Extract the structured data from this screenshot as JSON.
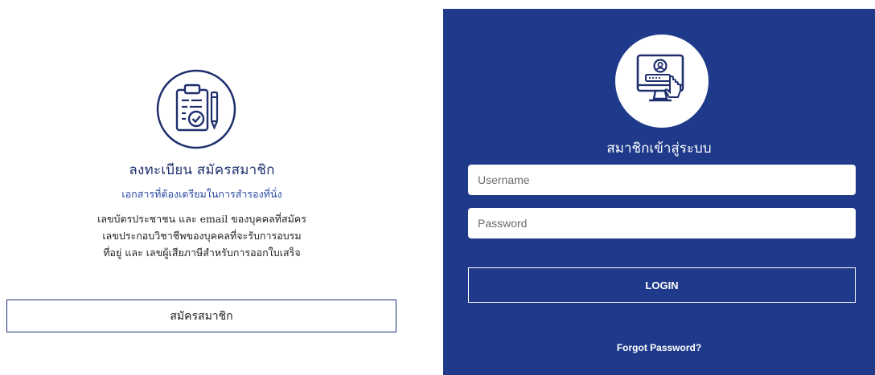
{
  "register": {
    "title": "ลงทะเบียน สมัครสมาชิก",
    "subtitle": "เอกสารที่ต้องเตรียมในการสำรองที่นั่ง",
    "description_lines": [
      "เลขบัตรประชาชน และ email ของบุคคลที่สมัคร",
      "เลขประกอบวิชาชีพของบุคคลที่จะรับการอบรม",
      "ที่อยู่ และ เลขผู้เสียภาษีสำหรับการออกใบเสร็จ"
    ],
    "button_label": "สมัครสมาชิก",
    "icon": "clipboard-check-icon"
  },
  "login": {
    "title": "สมาชิกเข้าสู่ระบบ",
    "username_placeholder": "Username",
    "password_placeholder": "Password",
    "button_label": "LOGIN",
    "forgot_label": "Forgot Password?",
    "icon": "computer-login-icon"
  },
  "colors": {
    "panel_blue": "#1f3a8a",
    "icon_navy": "#1f2f6e",
    "subtitle_blue": "#2d4aa8"
  }
}
